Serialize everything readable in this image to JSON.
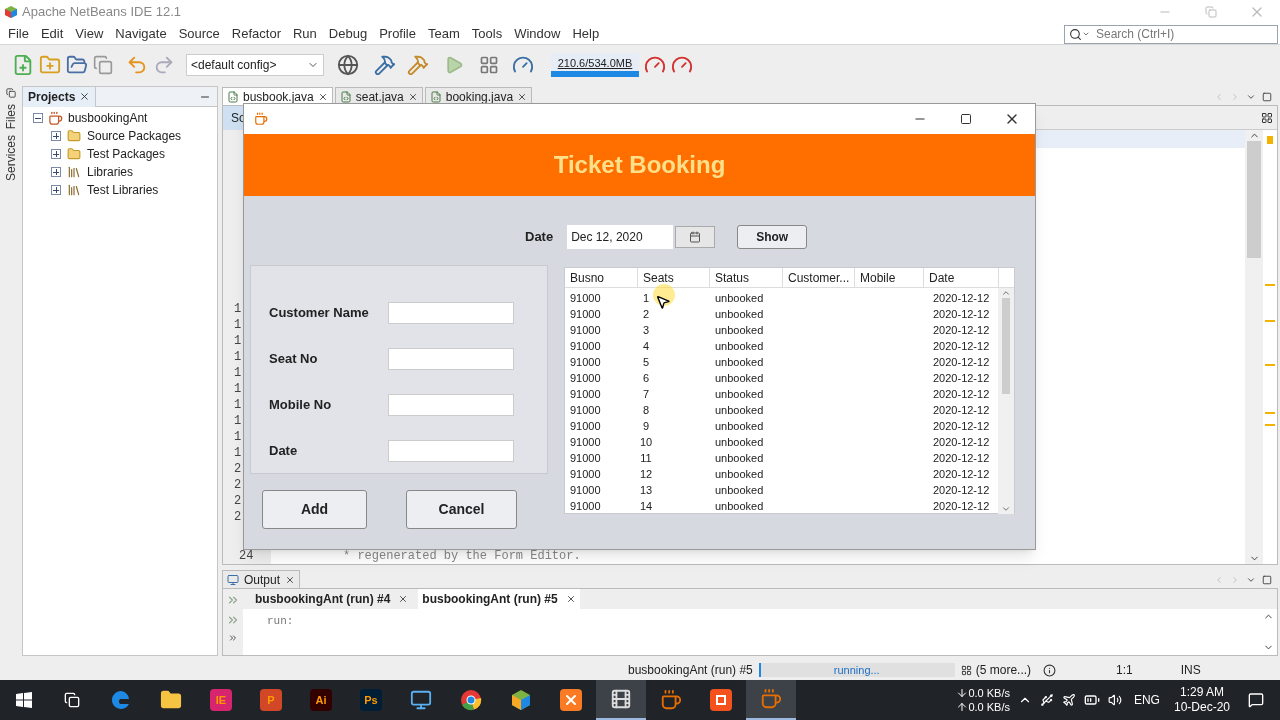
{
  "window": {
    "title": "Apache NetBeans IDE 12.1"
  },
  "menu": [
    "File",
    "Edit",
    "View",
    "Navigate",
    "Source",
    "Refactor",
    "Run",
    "Debug",
    "Profile",
    "Team",
    "Tools",
    "Window",
    "Help"
  ],
  "search": {
    "placeholder": "Search (Ctrl+I)"
  },
  "toolbar": {
    "config": "<default config>",
    "memory": "210.6/534.0MB"
  },
  "side_tabs": [
    "Files",
    "Services"
  ],
  "projects": {
    "title": "Projects",
    "root": {
      "label": "busbookingAnt",
      "expanded": true,
      "children": [
        {
          "label": "Source Packages",
          "expanded": false,
          "kind": "package"
        },
        {
          "label": "Test Packages",
          "expanded": false,
          "kind": "package"
        },
        {
          "label": "Libraries",
          "expanded": false,
          "kind": "library"
        },
        {
          "label": "Test Libraries",
          "expanded": false,
          "kind": "library"
        }
      ]
    }
  },
  "editor": {
    "tabs": [
      {
        "label": "busbook.java",
        "selected": true
      },
      {
        "label": "seat.java",
        "selected": false
      },
      {
        "label": "booking.java",
        "selected": false
      }
    ],
    "view_tab": "So",
    "gutter": [
      "1",
      "1",
      "1",
      "1",
      "1",
      "1",
      "1",
      "1",
      "1",
      "1",
      "2",
      "2",
      "2",
      "2"
    ],
    "last_line": "24",
    "code_line": "* regenerated by the Form Editor."
  },
  "dialog": {
    "heading": "Ticket Booking",
    "date_label": "Date",
    "date_value": "Dec 12, 2020",
    "show_button": "Show",
    "fields": [
      {
        "label": "Customer Name"
      },
      {
        "label": "Seat No"
      },
      {
        "label": "Mobile No"
      },
      {
        "label": "Date"
      }
    ],
    "buttons": [
      "Add",
      "Cancel"
    ],
    "table": {
      "columns": [
        "Busno",
        "Seats",
        "Status",
        "Customer...",
        "Mobile",
        "Date"
      ],
      "rows": [
        {
          "busno": "91000",
          "seats": "1",
          "status": "unbooked",
          "date": "2020-12-12"
        },
        {
          "busno": "91000",
          "seats": "2",
          "status": "unbooked",
          "date": "2020-12-12"
        },
        {
          "busno": "91000",
          "seats": "3",
          "status": "unbooked",
          "date": "2020-12-12"
        },
        {
          "busno": "91000",
          "seats": "4",
          "status": "unbooked",
          "date": "2020-12-12"
        },
        {
          "busno": "91000",
          "seats": "5",
          "status": "unbooked",
          "date": "2020-12-12"
        },
        {
          "busno": "91000",
          "seats": "6",
          "status": "unbooked",
          "date": "2020-12-12"
        },
        {
          "busno": "91000",
          "seats": "7",
          "status": "unbooked",
          "date": "2020-12-12"
        },
        {
          "busno": "91000",
          "seats": "8",
          "status": "unbooked",
          "date": "2020-12-12"
        },
        {
          "busno": "91000",
          "seats": "9",
          "status": "unbooked",
          "date": "2020-12-12"
        },
        {
          "busno": "91000",
          "seats": "10",
          "status": "unbooked",
          "date": "2020-12-12"
        },
        {
          "busno": "91000",
          "seats": "11",
          "status": "unbooked",
          "date": "2020-12-12"
        },
        {
          "busno": "91000",
          "seats": "12",
          "status": "unbooked",
          "date": "2020-12-12"
        },
        {
          "busno": "91000",
          "seats": "13",
          "status": "unbooked",
          "date": "2020-12-12"
        },
        {
          "busno": "91000",
          "seats": "14",
          "status": "unbooked",
          "date": "2020-12-12"
        }
      ]
    }
  },
  "output": {
    "title": "Output",
    "tabs": [
      {
        "label": "busbookingAnt (run) #4",
        "selected": false
      },
      {
        "label": "busbookingAnt (run) #5",
        "selected": true
      }
    ],
    "text": "run:"
  },
  "status_bar": {
    "task": "busbookingAnt (run) #5",
    "progress": "running...",
    "level": 0.01,
    "more": "(5 more...)",
    "position": "1:1",
    "mode": "INS"
  },
  "taskbar": {
    "apps": [
      {
        "kind": "edge",
        "active": false
      },
      {
        "kind": "folder",
        "active": false
      },
      {
        "kind": "letter",
        "label": "IE",
        "color": "#d6246e",
        "active": false
      },
      {
        "kind": "letter",
        "label": "P",
        "color": "#d24726",
        "active": false
      },
      {
        "kind": "letter",
        "label": "Ai",
        "color": "#330000",
        "active": false
      },
      {
        "kind": "letter",
        "label": "Ps",
        "color": "#001e36",
        "active": false
      },
      {
        "kind": "monitor",
        "active": false
      },
      {
        "kind": "chrome",
        "active": false
      },
      {
        "kind": "cube",
        "active": false
      },
      {
        "kind": "xampp",
        "active": false
      },
      {
        "kind": "clapper",
        "active": true
      },
      {
        "kind": "java",
        "active": false
      },
      {
        "kind": "recorder",
        "active": false
      },
      {
        "kind": "java",
        "active": true
      }
    ],
    "down_speed": "0.0 KB/s",
    "up_speed": "0.0 KB/s",
    "language": "ENG",
    "time": "1:29 AM",
    "date": "10-Dec-20"
  }
}
